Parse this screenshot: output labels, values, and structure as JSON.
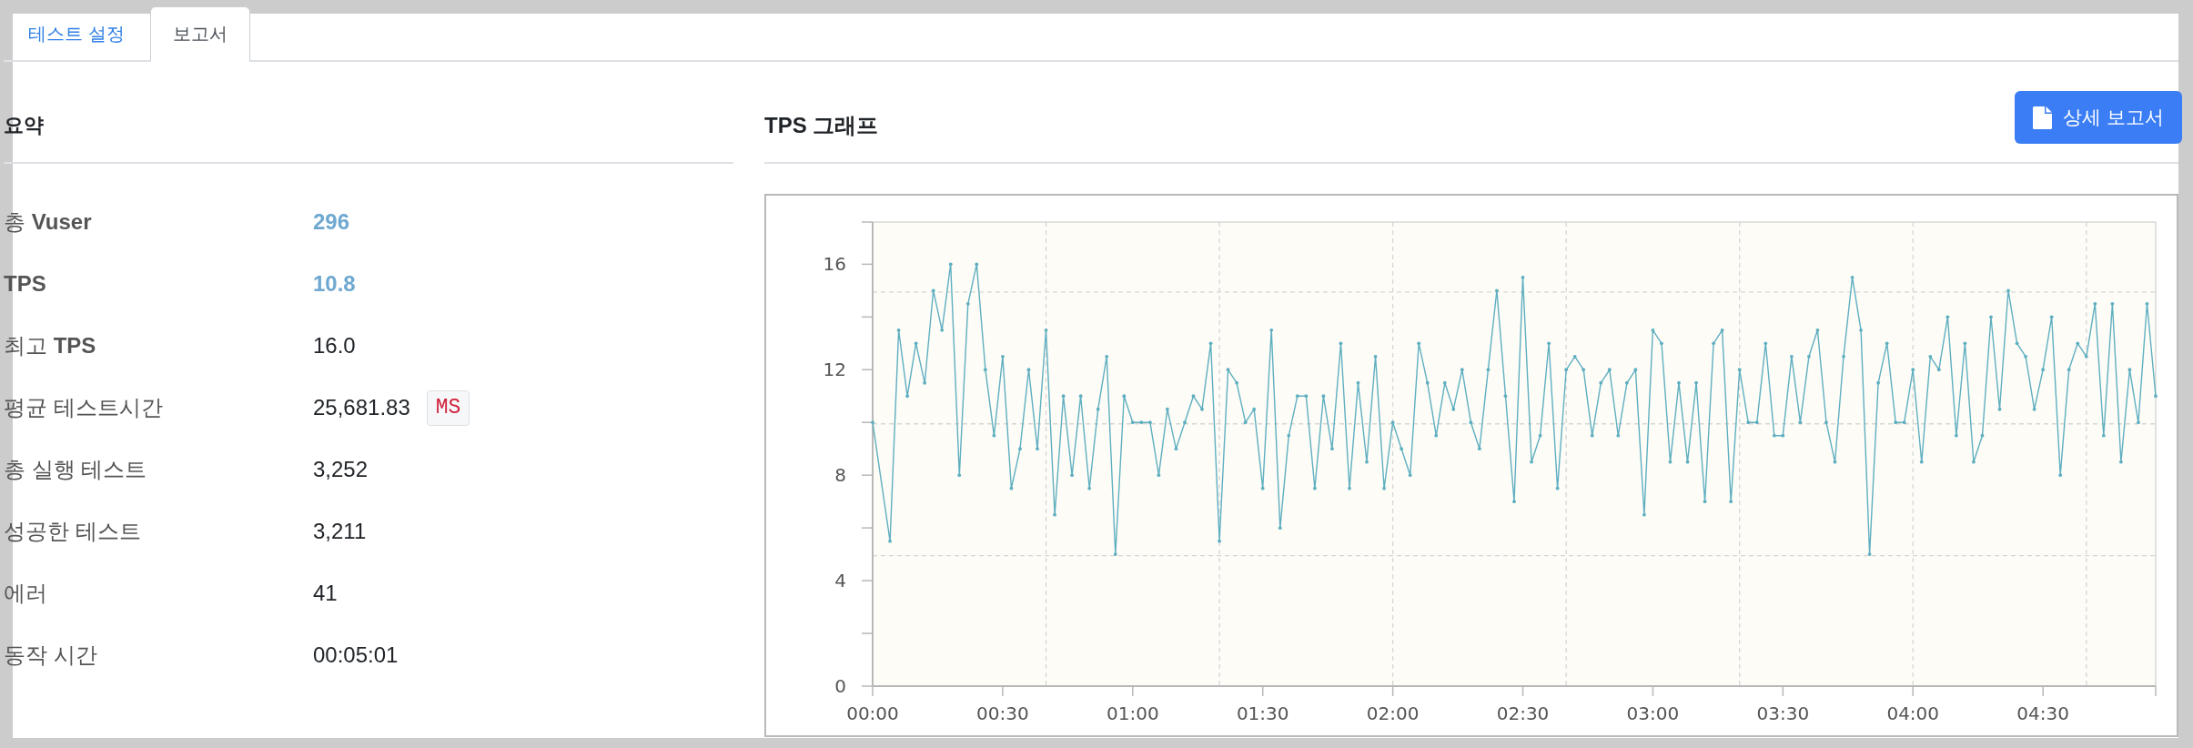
{
  "tabs": [
    {
      "label": "테스트 설정",
      "selected": false
    },
    {
      "label": "보고서",
      "selected": true
    }
  ],
  "summary": {
    "title": "요약",
    "rows": [
      {
        "label": "총 **Vuser**",
        "label_bold": false,
        "value": "296",
        "highlight": true
      },
      {
        "label": "TPS",
        "label_bold": true,
        "value": "10.8",
        "highlight": true
      },
      {
        "label": "최고 **TPS**",
        "label_bold": false,
        "value": "16.0",
        "highlight": false
      },
      {
        "label": "평균 테스트시간",
        "label_bold": false,
        "value": "25,681.83",
        "unit": "MS",
        "highlight": false
      },
      {
        "label": "총 실행 테스트",
        "label_bold": false,
        "value": "3,252",
        "highlight": false
      },
      {
        "label": "성공한 테스트",
        "label_bold": false,
        "value": "3,211",
        "highlight": false
      },
      {
        "label": "에러",
        "label_bold": false,
        "value": "41",
        "highlight": false
      },
      {
        "label": "동작 시간",
        "label_bold": false,
        "value": "00:05:01",
        "highlight": false
      }
    ]
  },
  "graph": {
    "title": "TPS 그래프",
    "button": "상세 보고서",
    "chart_data": {
      "type": "line",
      "x": [
        0,
        4,
        6,
        8,
        10,
        12,
        14,
        16,
        18,
        20,
        22,
        24,
        26,
        28,
        30,
        32,
        34,
        36,
        38,
        40,
        42,
        44,
        46,
        48,
        50,
        52,
        54,
        56,
        58,
        60,
        62,
        64,
        66,
        68,
        70,
        72,
        74,
        76,
        78,
        80,
        82,
        84,
        86,
        88,
        90,
        92,
        94,
        96,
        98,
        100,
        102,
        104,
        106,
        108,
        110,
        112,
        114,
        116,
        118,
        120,
        122,
        124,
        126,
        128,
        130,
        132,
        134,
        136,
        138,
        140,
        142,
        144,
        146,
        148,
        150,
        152,
        154,
        156,
        158,
        160,
        162,
        164,
        166,
        168,
        170,
        172,
        174,
        176,
        178,
        180,
        182,
        184,
        186,
        188,
        190,
        192,
        194,
        196,
        198,
        200,
        202,
        204,
        206,
        208,
        210,
        212,
        214,
        216,
        218,
        220,
        222,
        224,
        226,
        228,
        230,
        232,
        234,
        236,
        238,
        240,
        242,
        244,
        246,
        248,
        250,
        252,
        254,
        256,
        258,
        260,
        262,
        264,
        266,
        268,
        270,
        272,
        274,
        276,
        278,
        280,
        282,
        284,
        286,
        288,
        290,
        292,
        294,
        296
      ],
      "series": [
        {
          "color": "#5fafc0",
          "values": [
            10,
            5.5,
            13.5,
            11,
            13,
            11.5,
            15,
            13.5,
            16,
            8,
            14.5,
            16,
            12,
            9.5,
            12.5,
            7.5,
            9,
            12,
            9,
            13.5,
            6.5,
            11,
            8,
            11,
            7.5,
            10.5,
            12.5,
            5,
            11,
            10,
            10,
            10,
            8,
            10.5,
            9,
            10,
            11,
            10.5,
            13,
            5.5,
            12,
            11.5,
            10,
            10.5,
            7.5,
            13.5,
            6,
            9.5,
            11,
            11,
            7.5,
            11,
            9,
            13,
            7.5,
            11.5,
            8.5,
            12.5,
            7.5,
            10,
            9,
            8,
            13,
            11.5,
            9.5,
            11.5,
            10.5,
            12,
            10,
            9,
            12,
            15,
            11,
            7,
            15.5,
            8.5,
            9.5,
            13,
            7.5,
            12,
            12.5,
            12,
            9.5,
            11.5,
            12,
            9.5,
            11.5,
            12,
            6.5,
            13.5,
            13,
            8.5,
            11.5,
            8.5,
            11.5,
            7,
            13,
            13.5,
            7,
            12,
            10,
            10,
            13,
            9.5,
            9.5,
            12.5,
            10,
            12.5,
            13.5,
            10,
            8.5,
            12.5,
            15.5,
            13.5,
            5,
            11.5,
            13,
            10,
            10,
            12,
            8.5,
            12.5,
            12,
            14,
            9.5,
            13,
            8.5,
            9.5,
            14,
            10.5,
            15,
            13,
            12.5,
            10.5,
            12,
            14,
            8,
            12,
            13,
            12.5,
            14.5,
            9.5,
            14.5,
            8.5,
            12,
            10,
            14.5,
            11
          ]
        }
      ],
      "xlim": [
        0,
        296
      ],
      "ylim": [
        0,
        17.6
      ],
      "xticks": [
        {
          "value": 0,
          "label": "00:00"
        },
        {
          "value": 30,
          "label": "00:30"
        },
        {
          "value": 60,
          "label": "01:00"
        },
        {
          "value": 90,
          "label": "01:30"
        },
        {
          "value": 120,
          "label": "02:00"
        },
        {
          "value": 150,
          "label": "02:30"
        },
        {
          "value": 180,
          "label": "03:00"
        },
        {
          "value": 210,
          "label": "03:30"
        },
        {
          "value": 240,
          "label": "04:00"
        },
        {
          "value": 270,
          "label": "04:30"
        }
      ],
      "yticks": [
        0,
        4,
        8,
        12,
        16
      ]
    }
  }
}
